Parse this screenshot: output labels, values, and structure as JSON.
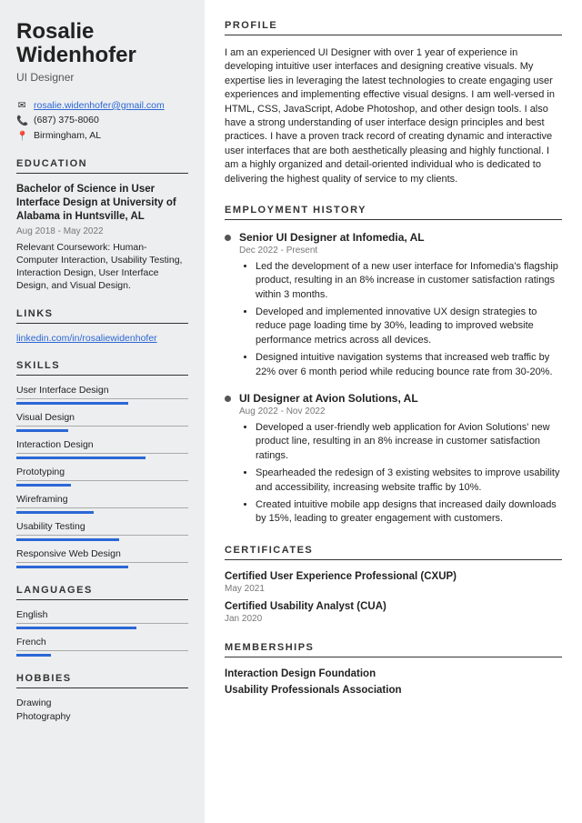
{
  "name": "Rosalie Widenhofer",
  "title": "UI Designer",
  "contact": {
    "email": "rosalie.widenhofer@gmail.com",
    "phone": "(687) 375-8060",
    "location": "Birmingham, AL"
  },
  "sections": {
    "education": "EDUCATION",
    "links": "LINKS",
    "skills": "SKILLS",
    "languages": "LANGUAGES",
    "hobbies": "HOBBIES",
    "profile": "PROFILE",
    "employment": "EMPLOYMENT HISTORY",
    "certificates": "CERTIFICATES",
    "memberships": "MEMBERSHIPS"
  },
  "education": {
    "degree": "Bachelor of Science in User Interface Design at University of Alabama in Huntsville, AL",
    "dates": "Aug 2018 - May 2022",
    "desc": "Relevant Coursework: Human-Computer Interaction, Usability Testing, Interaction Design, User Interface Design, and Visual Design."
  },
  "links": {
    "linkedin": "linkedin.com/in/rosaliewidenhofer"
  },
  "skills": [
    {
      "name": "User Interface Design",
      "level": 65
    },
    {
      "name": "Visual Design",
      "level": 30
    },
    {
      "name": "Interaction Design",
      "level": 75
    },
    {
      "name": "Prototyping",
      "level": 32
    },
    {
      "name": "Wireframing",
      "level": 45
    },
    {
      "name": "Usability Testing",
      "level": 60
    },
    {
      "name": "Responsive Web Design",
      "level": 65
    }
  ],
  "languages": [
    {
      "name": "English",
      "level": 70
    },
    {
      "name": "French",
      "level": 20
    }
  ],
  "hobbies": [
    "Drawing",
    "Photography"
  ],
  "profile": "I am an experienced UI Designer with over 1 year of experience in developing intuitive user interfaces and designing creative visuals. My expertise lies in leveraging the latest technologies to create engaging user experiences and implementing effective visual designs. I am well-versed in HTML, CSS, JavaScript, Adobe Photoshop, and other design tools. I also have a strong understanding of user interface design principles and best practices. I have a proven track record of creating dynamic and interactive user interfaces that are both aesthetically pleasing and highly functional. I am a highly organized and detail-oriented individual who is dedicated to delivering the highest quality of service to my clients.",
  "jobs": [
    {
      "title": "Senior UI Designer at Infomedia, AL",
      "dates": "Dec 2022 - Present",
      "bullets": [
        "Led the development of a new user interface for Infomedia's flagship product, resulting in an 8% increase in customer satisfaction ratings within 3 months.",
        "Developed and implemented innovative UX design strategies to reduce page loading time by 30%, leading to improved website performance metrics across all devices.",
        "Designed intuitive navigation systems that increased web traffic by 22% over 6 month period while reducing bounce rate from 30-20%."
      ]
    },
    {
      "title": "UI Designer at Avion Solutions, AL",
      "dates": "Aug 2022 - Nov 2022",
      "bullets": [
        "Developed a user-friendly web application for Avion Solutions' new product line, resulting in an 8% increase in customer satisfaction ratings.",
        "Spearheaded the redesign of 3 existing websites to improve usability and accessibility, increasing website traffic by 10%.",
        "Created intuitive mobile app designs that increased daily downloads by 15%, leading to greater engagement with customers."
      ]
    }
  ],
  "certificates": [
    {
      "name": "Certified User Experience Professional (CXUP)",
      "date": "May 2021"
    },
    {
      "name": "Certified Usability Analyst (CUA)",
      "date": "Jan 2020"
    }
  ],
  "memberships": [
    "Interaction Design Foundation",
    "Usability Professionals Association"
  ]
}
